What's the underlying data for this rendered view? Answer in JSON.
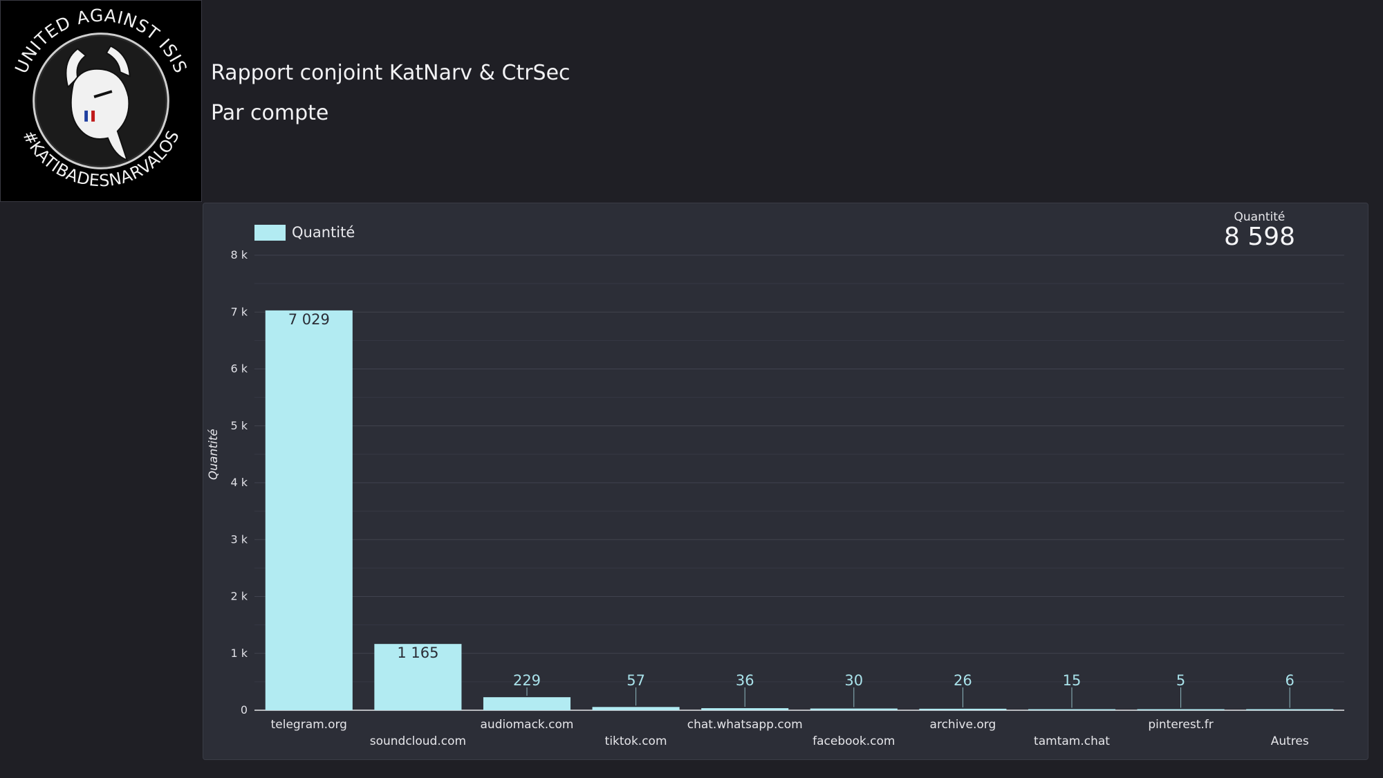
{
  "header": {
    "title": "Rapport conjoint KatNarv & CtrSec",
    "subtitle": "Par compte"
  },
  "logo": {
    "top_text": "UNITED AGAINST ISIS",
    "bottom_text": "#KATIBADESNARVALOS"
  },
  "kpi": {
    "label": "Quantité",
    "value": "8 598"
  },
  "colors": {
    "bar": "#b2ebf2",
    "background": "#1f1f25",
    "panel": "#2c2e37"
  },
  "chart_data": {
    "type": "bar",
    "legend": "Quantité",
    "legend_position": "top-left",
    "ylabel": "Quantité",
    "xlabel": "",
    "ylim": [
      0,
      8000
    ],
    "yticks": [
      0,
      1000,
      2000,
      3000,
      4000,
      5000,
      6000,
      7000,
      8000
    ],
    "ytick_labels": [
      "0",
      "1 k",
      "2 k",
      "3 k",
      "4 k",
      "5 k",
      "6 k",
      "7 k",
      "8 k"
    ],
    "grid": true,
    "categories": [
      "telegram.org",
      "soundcloud.com",
      "audiomack.com",
      "tiktok.com",
      "chat.whatsapp.com",
      "facebook.com",
      "archive.org",
      "tamtam.chat",
      "pinterest.fr",
      "Autres"
    ],
    "values": [
      7029,
      1165,
      229,
      57,
      36,
      30,
      26,
      15,
      5,
      6
    ],
    "value_labels": [
      "7 029",
      "1 165",
      "229",
      "57",
      "36",
      "30",
      "26",
      "15",
      "5",
      "6"
    ]
  }
}
